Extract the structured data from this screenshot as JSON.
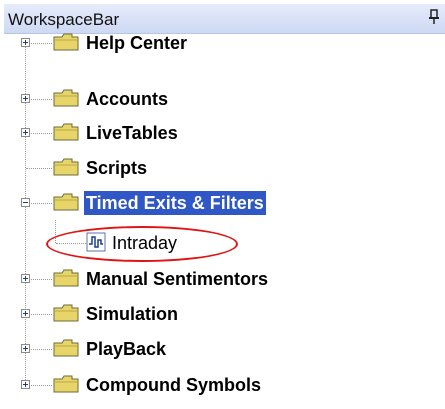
{
  "workspace": {
    "title": "WorkspaceBar",
    "pin_icon": "pin-icon"
  },
  "tree": {
    "items": [
      {
        "label": "Help Center",
        "toggle": "plus",
        "icon": "folder-icon"
      },
      {
        "label": "Accounts",
        "toggle": "plus",
        "icon": "folder-icon"
      },
      {
        "label": "LiveTables",
        "toggle": "plus",
        "icon": "folder-icon"
      },
      {
        "label": "Scripts",
        "toggle": "none",
        "icon": "folder-icon"
      },
      {
        "label": "Timed Exits & Filters",
        "toggle": "minus",
        "icon": "folder-icon",
        "selected": true,
        "children": [
          {
            "label": "Intraday",
            "icon": "indicator-icon",
            "annotated": true
          }
        ]
      },
      {
        "label": "Manual Sentimentors",
        "toggle": "plus",
        "icon": "folder-icon"
      },
      {
        "label": "Simulation",
        "toggle": "plus",
        "icon": "folder-icon"
      },
      {
        "label": "PlayBack",
        "toggle": "plus",
        "icon": "folder-icon"
      },
      {
        "label": "Compound Symbols",
        "toggle": "plus",
        "icon": "folder-icon"
      }
    ]
  },
  "colors": {
    "selection": "#2f57c6",
    "annotation": "#e01414",
    "folder": "#e8d56a"
  }
}
